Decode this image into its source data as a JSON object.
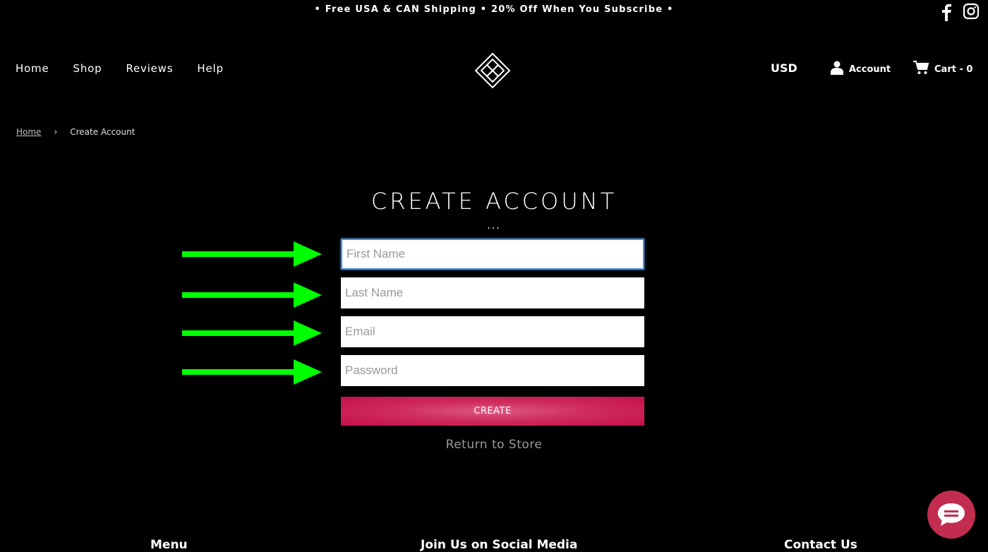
{
  "announcement": "• Free USA & CAN Shipping • 20% Off When You Subscribe •",
  "nav": {
    "items": [
      "Home",
      "Shop",
      "Reviews",
      "Help"
    ]
  },
  "header": {
    "currency": "USD",
    "account_label": "Account",
    "cart_label": "Cart - 0"
  },
  "breadcrumb": {
    "home": "Home",
    "separator": "›",
    "current": "Create Account"
  },
  "form": {
    "title": "CREATE ACCOUNT",
    "dots": "...",
    "first_name_placeholder": "First Name",
    "last_name_placeholder": "Last Name",
    "email_placeholder": "Email",
    "password_placeholder": "Password",
    "create_label": "CREATE",
    "return_label": "Return to Store"
  },
  "footer": {
    "menu": "Menu",
    "social": "Join Us on Social Media",
    "contact": "Contact Us"
  },
  "colors": {
    "background": "#000000",
    "button": "#c81a52",
    "arrow": "#00ff00",
    "chat": "#c22d4f"
  }
}
